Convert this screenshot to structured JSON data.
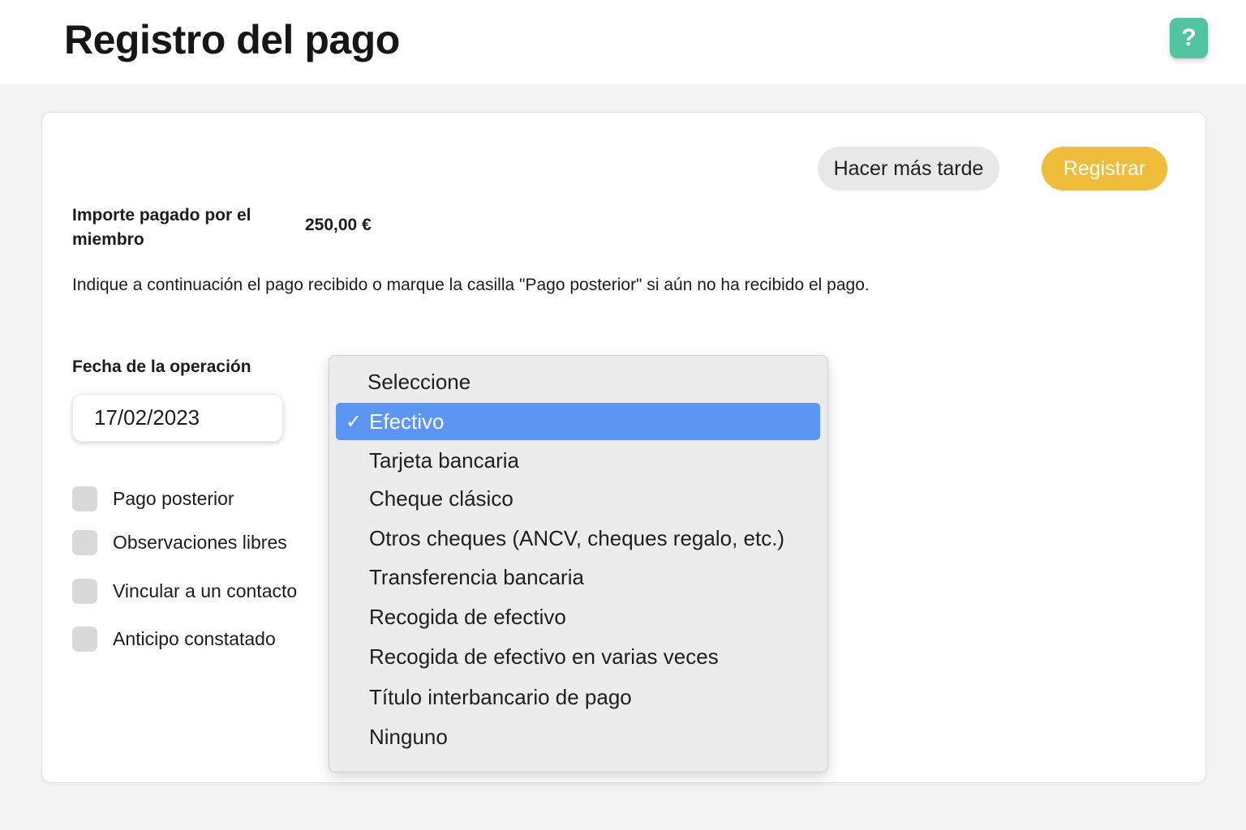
{
  "header": {
    "title": "Registro del pago",
    "help_label": "?"
  },
  "actions": {
    "later_label": "Hacer más tarde",
    "register_label": "Registrar"
  },
  "amount": {
    "label": "Importe pagado por el miembro",
    "value": "250,00 €"
  },
  "instructions": "Indique a continuación el pago recibido o marque la casilla \"Pago posterior\" si aún no ha recibido el pago.",
  "date": {
    "label": "Fecha de la operación",
    "value": "17/02/2023"
  },
  "checkboxes": [
    {
      "label": "Pago posterior",
      "checked": false
    },
    {
      "label": "Observaciones libres",
      "checked": false
    },
    {
      "label": "Vincular a un contacto",
      "checked": false
    },
    {
      "label": "Anticipo constatado",
      "checked": false
    }
  ],
  "payment_method": {
    "placeholder": "Seleccione",
    "selected": "Efectivo",
    "check_mark": "✓",
    "options": [
      "Tarjeta bancaria",
      "Cheque clásico",
      "Otros cheques (ANCV, cheques regalo, etc.)",
      "Transferencia bancaria",
      "Recogida de efectivo",
      "Recogida de efectivo en varias veces",
      "Título interbancario de pago",
      "Ninguno"
    ]
  },
  "colors": {
    "accent": "#f0bc3c",
    "help": "#52c5a0",
    "selection": "#5b96f4"
  }
}
